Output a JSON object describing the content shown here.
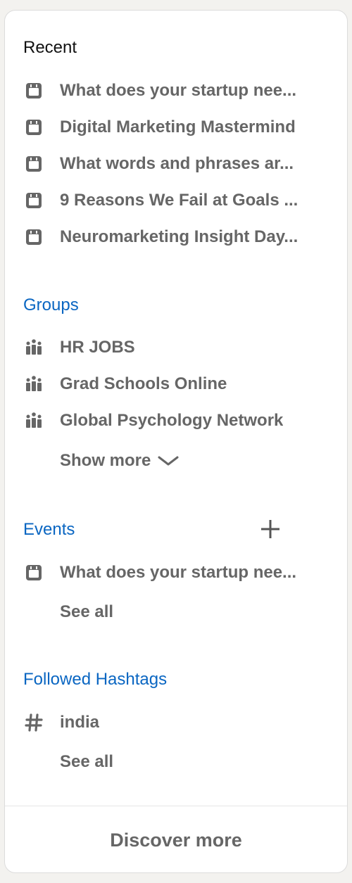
{
  "recent": {
    "heading": "Recent",
    "items": [
      {
        "label": "What does your startup nee...",
        "icon": "calendar-icon"
      },
      {
        "label": "Digital Marketing Mastermind",
        "icon": "calendar-icon"
      },
      {
        "label": "What words and phrases ar...",
        "icon": "calendar-icon"
      },
      {
        "label": "9 Reasons We Fail at Goals ...",
        "icon": "calendar-icon"
      },
      {
        "label": "Neuromarketing Insight Day...",
        "icon": "calendar-icon"
      }
    ]
  },
  "groups": {
    "heading": "Groups",
    "items": [
      {
        "label": "HR JOBS",
        "icon": "group-icon"
      },
      {
        "label": "Grad Schools Online",
        "icon": "group-icon"
      },
      {
        "label": "Global Psychology Network",
        "icon": "group-icon"
      }
    ],
    "show_more": "Show more"
  },
  "events": {
    "heading": "Events",
    "items": [
      {
        "label": "What does your startup nee...",
        "icon": "calendar-icon"
      }
    ],
    "see_all": "See all"
  },
  "hashtags": {
    "heading": "Followed Hashtags",
    "items": [
      {
        "label": "india",
        "icon": "hashtag-icon"
      }
    ],
    "see_all": "See all"
  },
  "footer": {
    "discover_more": "Discover more"
  },
  "colors": {
    "link_blue": "#0a66c2",
    "text_gray": "#666666",
    "icon_gray": "#666666"
  }
}
